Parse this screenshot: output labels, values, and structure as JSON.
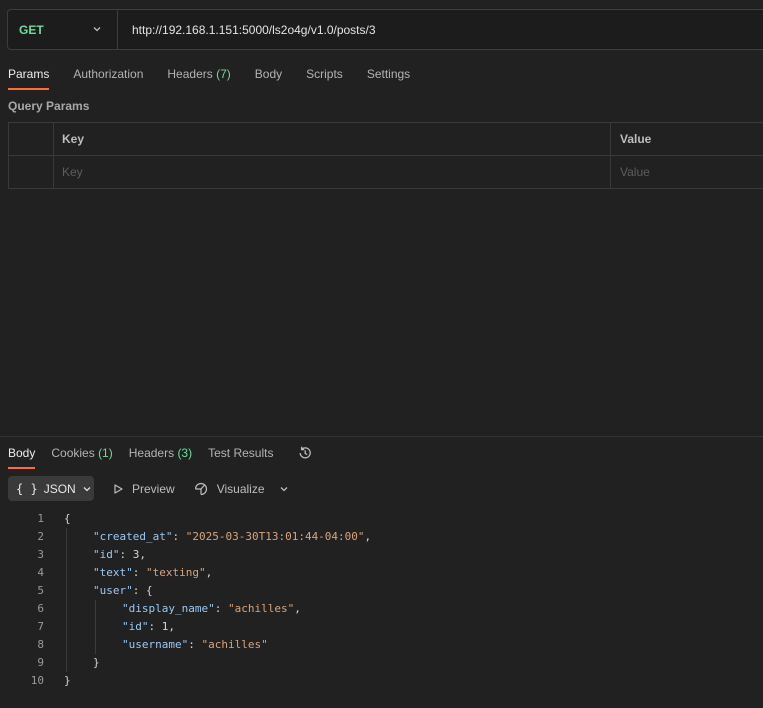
{
  "request": {
    "method": "GET",
    "url": "http://192.168.1.151:5000/ls2o4g/v1.0/posts/3"
  },
  "request_tabs": [
    {
      "label": "Params",
      "badge": ""
    },
    {
      "label": "Authorization",
      "badge": ""
    },
    {
      "label": "Headers",
      "badge": "(7)"
    },
    {
      "label": "Body",
      "badge": ""
    },
    {
      "label": "Scripts",
      "badge": ""
    },
    {
      "label": "Settings",
      "badge": ""
    }
  ],
  "query_params": {
    "title": "Query Params",
    "headers": {
      "key": "Key",
      "value": "Value"
    },
    "placeholders": {
      "key": "Key",
      "value": "Value"
    }
  },
  "response_tabs": [
    {
      "label": "Body",
      "badge": ""
    },
    {
      "label": "Cookies",
      "badge": "(1)"
    },
    {
      "label": "Headers",
      "badge": "(3)"
    },
    {
      "label": "Test Results",
      "badge": ""
    }
  ],
  "response_toolbar": {
    "format_braces": "{ }",
    "format": "JSON",
    "preview": "Preview",
    "visualize": "Visualize"
  },
  "response_body": {
    "lines": [
      {
        "n": "1",
        "parts": [
          [
            "p",
            "{"
          ]
        ],
        "indent": 0
      },
      {
        "n": "2",
        "parts": [
          [
            "k",
            "\"created_at\""
          ],
          [
            "p",
            ": "
          ],
          [
            "s",
            "\"2025-03-30T13:01:44-04:00\""
          ],
          [
            "p",
            ","
          ]
        ],
        "indent": 1
      },
      {
        "n": "3",
        "parts": [
          [
            "k",
            "\"id\""
          ],
          [
            "p",
            ": "
          ],
          [
            "n",
            "3"
          ],
          [
            "p",
            ","
          ]
        ],
        "indent": 1
      },
      {
        "n": "4",
        "parts": [
          [
            "k",
            "\"text\""
          ],
          [
            "p",
            ": "
          ],
          [
            "s",
            "\"texting\""
          ],
          [
            "p",
            ","
          ]
        ],
        "indent": 1
      },
      {
        "n": "5",
        "parts": [
          [
            "k",
            "\"user\""
          ],
          [
            "p",
            ": {"
          ]
        ],
        "indent": 1
      },
      {
        "n": "6",
        "parts": [
          [
            "k",
            "\"display_name\""
          ],
          [
            "p",
            ": "
          ],
          [
            "s",
            "\"achilles\""
          ],
          [
            "p",
            ","
          ]
        ],
        "indent": 2
      },
      {
        "n": "7",
        "parts": [
          [
            "k",
            "\"id\""
          ],
          [
            "p",
            ": "
          ],
          [
            "n",
            "1"
          ],
          [
            "p",
            ","
          ]
        ],
        "indent": 2
      },
      {
        "n": "8",
        "parts": [
          [
            "k",
            "\"username\""
          ],
          [
            "p",
            ": "
          ],
          [
            "s",
            "\"achilles\""
          ]
        ],
        "indent": 2
      },
      {
        "n": "9",
        "parts": [
          [
            "p",
            "}"
          ]
        ],
        "indent": 1
      },
      {
        "n": "10",
        "parts": [
          [
            "p",
            "}"
          ]
        ],
        "indent": 0
      }
    ]
  },
  "colors": {
    "accent": "#ff6c37",
    "method_get": "#6bdd9a",
    "json_key": "#9cc8f2",
    "json_string": "#d7a47e"
  }
}
